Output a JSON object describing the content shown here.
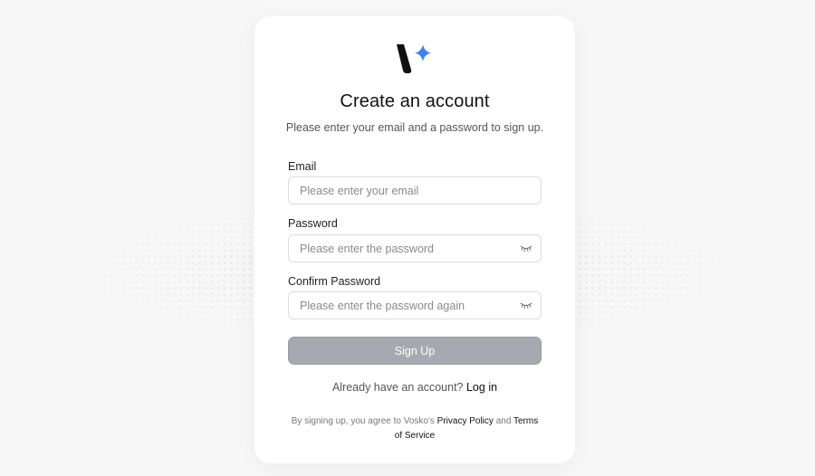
{
  "header": {
    "title": "Create an account",
    "subtitle": "Please enter your email and a password to sign up."
  },
  "logo": {
    "icon": "sparkle-v-logo",
    "accent_color": "#3b82f6",
    "mark_color": "#111111"
  },
  "form": {
    "email": {
      "label": "Email",
      "value": "",
      "placeholder": "Please enter your email"
    },
    "password": {
      "label": "Password",
      "value": "",
      "placeholder": "Please enter the password",
      "toggle_icon": "eye-closed-icon"
    },
    "confirm_password": {
      "label": "Confirm Password",
      "value": "",
      "placeholder": "Please enter the password again",
      "toggle_icon": "eye-closed-icon"
    },
    "submit_label": "Sign Up"
  },
  "login_prompt": {
    "text": "Already have an account? ",
    "link_label": "Log in"
  },
  "terms": {
    "prefix": "By signing up, you agree to Vosko's ",
    "privacy_label": "Privacy Policy",
    "conjunction": " and ",
    "terms_label": "Terms of Service"
  }
}
